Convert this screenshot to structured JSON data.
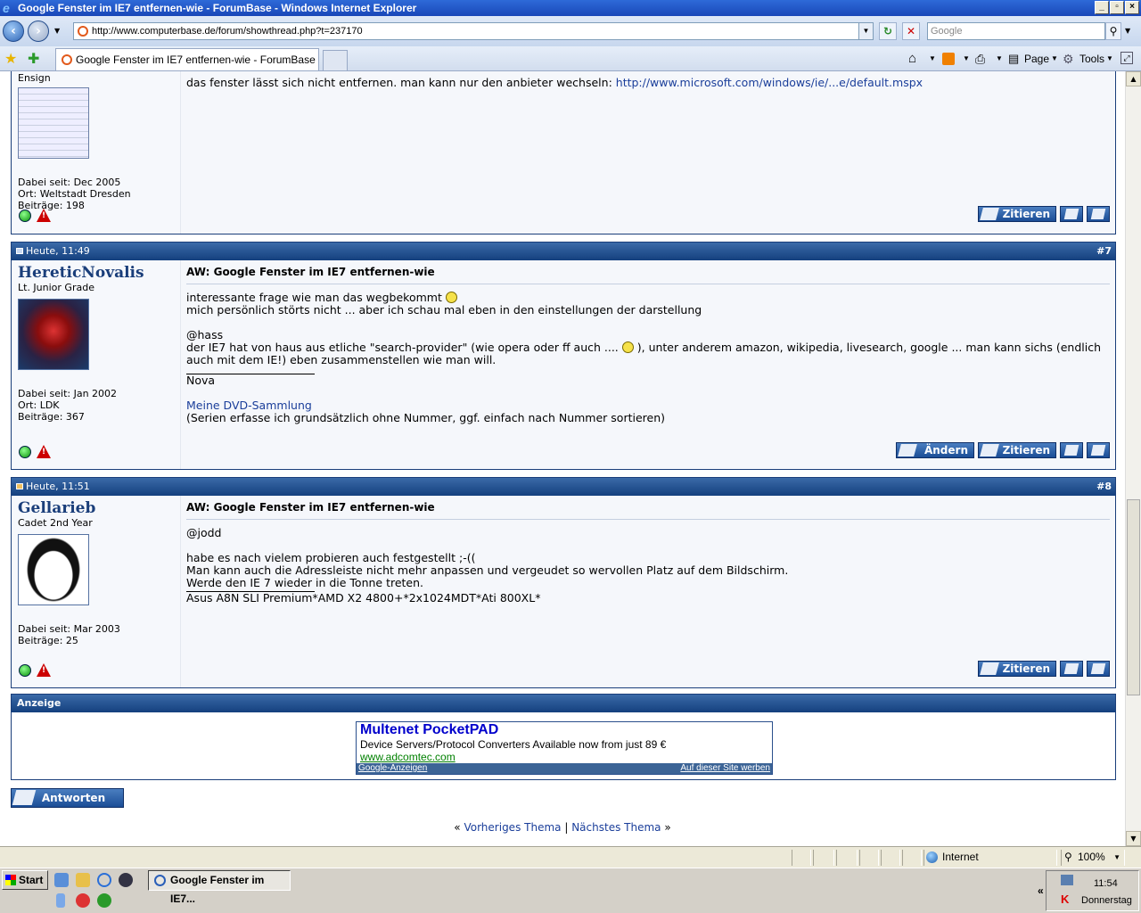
{
  "window": {
    "title": "Google Fenster im IE7 entfernen-wie - ForumBase - Windows Internet Explorer"
  },
  "browser": {
    "address": "http://www.computerbase.de/forum/showthread.php?t=237170",
    "search_placeholder": "Google",
    "tab_title": "Google Fenster im IE7 entfernen-wie - ForumBase",
    "toolbar": {
      "page_label": "Page",
      "tools_label": "Tools"
    }
  },
  "posts": [
    {
      "rank": "Ensign",
      "joined": "Dabei seit: Dec 2005",
      "location": "Ort: Weltstadt Dresden",
      "posts_count": "Beiträge: 198",
      "text": "das fenster lässt sich nicht entfernen. man kann nur den anbieter wechseln: ",
      "link": "http://www.microsoft.com/windows/ie/...e/default.mspx",
      "quote_label": "Zitieren"
    },
    {
      "date": "Heute, 11:49",
      "number": "#7",
      "username": "HereticNovalis",
      "rank": "Lt. Junior Grade",
      "joined": "Dabei seit: Jan 2002",
      "location": "Ort: LDK",
      "posts_count": "Beiträge: 367",
      "title": "AW: Google Fenster im IE7 entfernen-wie",
      "line1": "interessante frage wie man das wegbekommt ",
      "line2": "mich persönlich störts nicht ... aber ich schau mal eben in den einstellungen der darstellung",
      "line3": "@hass",
      "line4a": "der IE7 hat von haus aus etliche \"search-provider\" (wie opera oder ff auch .... ",
      "line4b": " ), unter anderem amazon, wikipedia, livesearch, google ... man kann sichs (endlich auch mit dem IE!) eben zusammenstellen wie man will.",
      "sig_name": "Nova",
      "sig_link": "Meine DVD-Sammlung",
      "sig_text": "(Serien erfasse ich grundsätzlich ohne Nummer, ggf. einfach nach Nummer sortieren)",
      "edit_label": "Ändern",
      "quote_label": "Zitieren"
    },
    {
      "date": "Heute, 11:51",
      "number": "#8",
      "username": "Gellarieb",
      "rank": "Cadet 2nd Year",
      "joined": "Dabei seit: Mar 2003",
      "posts_count": "Beiträge: 25",
      "title": "AW: Google Fenster im IE7 entfernen-wie",
      "line1": "@jodd",
      "line2": "habe es nach vielem probieren auch festgestellt ;-((",
      "line3": "Man kann auch die Adressleiste nicht mehr anpassen und vergeudet so wervollen Platz auf dem Bildschirm.",
      "line4": "Werde den IE 7 wieder in die Tonne treten.",
      "sig": "Asus A8N SLI Premium*AMD X2 4800+*2x1024MDT*Ati 800XL*",
      "quote_label": "Zitieren"
    }
  ],
  "ad": {
    "header": "Anzeige",
    "title": "Multenet PocketPAD",
    "description": "Device Servers/Protocol Converters Available now from just 89 €",
    "url": "www.adcomtec.com",
    "footer_left": "Google-Anzeigen",
    "footer_right": "Auf dieser Site werben"
  },
  "reply_label": "Antworten",
  "thread_nav": {
    "prev": "Vorheriges Thema",
    "separator": "|",
    "next": "Nächstes Thema",
    "left_quote": "«",
    "right_quote": "»"
  },
  "statusbar": {
    "zone": "Internet",
    "zoom": "100%"
  },
  "taskbar": {
    "start_label": "Start",
    "task_label": "Google Fenster im IE7...",
    "time": "11:54",
    "day": "Donnerstag"
  }
}
